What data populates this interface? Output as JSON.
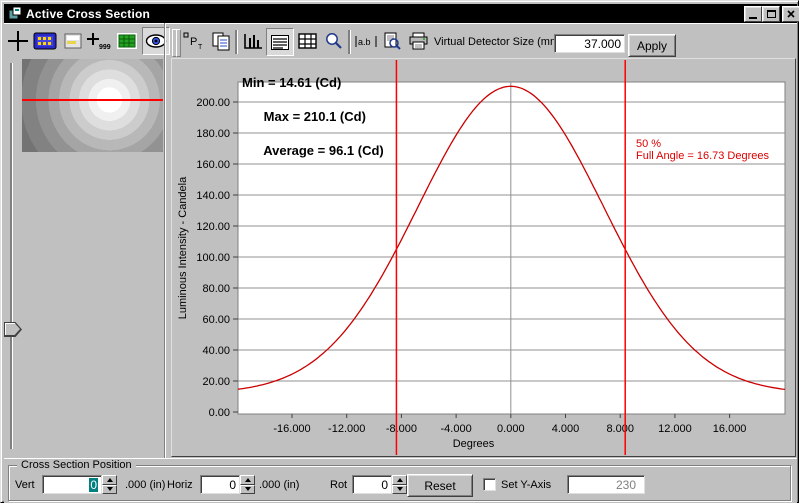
{
  "window": {
    "title": "Active Cross Section",
    "controls": {
      "minimize": "minimize",
      "maximize": "maximize",
      "close": "close"
    }
  },
  "toolbar_left": {
    "buttons": [
      {
        "name": "crosshair-tool",
        "pressed": false
      },
      {
        "name": "detector-tool",
        "pressed": false
      },
      {
        "name": "surface-tool",
        "pressed": false
      },
      {
        "name": "point-value-tool",
        "pressed": false
      },
      {
        "name": "raster-grid-tool",
        "pressed": false
      },
      {
        "name": "eye-view-tool",
        "pressed": true
      }
    ]
  },
  "toolbar_right": {
    "buttons": [
      {
        "name": "point-label-tool",
        "pressed": false
      },
      {
        "name": "copy-tool",
        "pressed": false
      },
      {
        "name": "histogram-view-tool",
        "pressed": false
      },
      {
        "name": "profile-view-tool",
        "pressed": true
      },
      {
        "name": "table-view-tool",
        "pressed": false
      },
      {
        "name": "zoom-tool",
        "pressed": false
      },
      {
        "name": "text-label-tool",
        "pressed": false
      },
      {
        "name": "print-preview-tool",
        "pressed": false
      },
      {
        "name": "print-tool",
        "pressed": false
      }
    ],
    "detector_label": "Virtual Detector Size (mm)",
    "detector_value": "37.000",
    "apply_label": "Apply"
  },
  "chart_data": {
    "type": "line",
    "xlabel": "Degrees",
    "ylabel": "Luminous Intensity - Candela",
    "xlim": [
      -19.95,
      20.05
    ],
    "ylim": [
      -1.3,
      212.9
    ],
    "x_ticks": [
      -16,
      -12,
      -8,
      -4,
      0,
      4,
      8,
      12,
      16
    ],
    "x_tick_labels": [
      "-16.000",
      "-12.000",
      "-8.000",
      "-4.000",
      "0.000",
      "4.000",
      "8.000",
      "12.000",
      "16.000"
    ],
    "y_ticks": [
      0,
      20,
      40,
      60,
      80,
      100,
      120,
      140,
      160,
      180,
      200
    ],
    "y_tick_labels": [
      "0.00",
      "20.00",
      "40.00",
      "60.00",
      "80.00",
      "100.00",
      "120.00",
      "140.00",
      "160.00",
      "180.00",
      "200.00"
    ],
    "grid": {
      "horizontal": true,
      "vertical_at_zero": true,
      "color": "#909090"
    },
    "series": [
      {
        "name": "luminous-intensity-cross-section",
        "color": "#cc0000",
        "model": {
          "kind": "gaussian",
          "baseline": 12.0,
          "amplitude": 198.1,
          "center": 0,
          "sigma": 6.8
        },
        "points": [
          [
            -20,
            14.6
          ],
          [
            -19,
            16.0
          ],
          [
            -18,
            18.0
          ],
          [
            -17,
            20.7
          ],
          [
            -16,
            24.4
          ],
          [
            -15,
            29.4
          ],
          [
            -14,
            35.8
          ],
          [
            -13,
            43.9
          ],
          [
            -12,
            53.7
          ],
          [
            -11,
            65.5
          ],
          [
            -10,
            79.2
          ],
          [
            -9,
            94.5
          ],
          [
            -8,
            111.2
          ],
          [
            -7,
            128.6
          ],
          [
            -6,
            146.2
          ],
          [
            -5,
            163.2
          ],
          [
            -4,
            178.6
          ],
          [
            -3,
            191.7
          ],
          [
            -2,
            201.7
          ],
          [
            -1,
            208.0
          ],
          [
            0,
            210.1
          ],
          [
            1,
            208.0
          ],
          [
            2,
            201.7
          ],
          [
            3,
            191.7
          ],
          [
            4,
            178.6
          ],
          [
            5,
            163.2
          ],
          [
            6,
            146.2
          ],
          [
            7,
            128.6
          ],
          [
            8,
            111.2
          ],
          [
            9,
            94.5
          ],
          [
            10,
            79.2
          ],
          [
            11,
            65.5
          ],
          [
            12,
            53.7
          ],
          [
            13,
            43.9
          ],
          [
            14,
            35.8
          ],
          [
            15,
            29.4
          ],
          [
            16,
            24.4
          ],
          [
            17,
            20.7
          ],
          [
            18,
            18.0
          ],
          [
            19,
            16.0
          ],
          [
            20,
            14.6
          ]
        ]
      }
    ],
    "stats": {
      "min": 14.61,
      "max": 210.1,
      "average": 96.1,
      "min_label": "Min = 14.61 (Cd)",
      "max_label": "Max = 210.1 (Cd)",
      "avg_label": "Average = 96.1 (Cd)"
    },
    "half_max_markers": {
      "x": [
        -8.365,
        8.365
      ],
      "color": "#ff0000",
      "percent_label": "50 %",
      "full_angle_label": "Full Angle = 16.73 Degrees",
      "full_angle_degrees": 16.73
    }
  },
  "bottom": {
    "group_label": "Cross Section Position",
    "vert_label": "Vert",
    "vert_value": "0",
    "vert_units": ".000 (in)",
    "horiz_label": "Horiz",
    "horiz_value": "0",
    "horiz_units": ".000 (in)",
    "rot_label": "Rot",
    "rot_value": "0",
    "reset_label": "Reset",
    "set_y_axis_label": "Set Y-Axis",
    "y_axis_value": "230"
  },
  "colors": {
    "window_face": "#c0c0c0",
    "titlebar": "#000000",
    "plot_background": "#ffffff",
    "grid": "#909090",
    "curve": "#cc0000",
    "marker_lines": "#ff0000",
    "selection": "#008080"
  }
}
